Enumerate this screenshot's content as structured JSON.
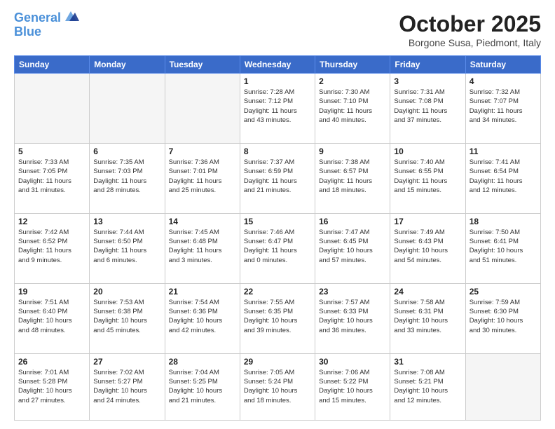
{
  "header": {
    "logo_line1": "General",
    "logo_line2": "Blue",
    "month_title": "October 2025",
    "location": "Borgone Susa, Piedmont, Italy"
  },
  "weekdays": [
    "Sunday",
    "Monday",
    "Tuesday",
    "Wednesday",
    "Thursday",
    "Friday",
    "Saturday"
  ],
  "weeks": [
    [
      {
        "day": "",
        "info": ""
      },
      {
        "day": "",
        "info": ""
      },
      {
        "day": "",
        "info": ""
      },
      {
        "day": "1",
        "info": "Sunrise: 7:28 AM\nSunset: 7:12 PM\nDaylight: 11 hours\nand 43 minutes."
      },
      {
        "day": "2",
        "info": "Sunrise: 7:30 AM\nSunset: 7:10 PM\nDaylight: 11 hours\nand 40 minutes."
      },
      {
        "day": "3",
        "info": "Sunrise: 7:31 AM\nSunset: 7:08 PM\nDaylight: 11 hours\nand 37 minutes."
      },
      {
        "day": "4",
        "info": "Sunrise: 7:32 AM\nSunset: 7:07 PM\nDaylight: 11 hours\nand 34 minutes."
      }
    ],
    [
      {
        "day": "5",
        "info": "Sunrise: 7:33 AM\nSunset: 7:05 PM\nDaylight: 11 hours\nand 31 minutes."
      },
      {
        "day": "6",
        "info": "Sunrise: 7:35 AM\nSunset: 7:03 PM\nDaylight: 11 hours\nand 28 minutes."
      },
      {
        "day": "7",
        "info": "Sunrise: 7:36 AM\nSunset: 7:01 PM\nDaylight: 11 hours\nand 25 minutes."
      },
      {
        "day": "8",
        "info": "Sunrise: 7:37 AM\nSunset: 6:59 PM\nDaylight: 11 hours\nand 21 minutes."
      },
      {
        "day": "9",
        "info": "Sunrise: 7:38 AM\nSunset: 6:57 PM\nDaylight: 11 hours\nand 18 minutes."
      },
      {
        "day": "10",
        "info": "Sunrise: 7:40 AM\nSunset: 6:55 PM\nDaylight: 11 hours\nand 15 minutes."
      },
      {
        "day": "11",
        "info": "Sunrise: 7:41 AM\nSunset: 6:54 PM\nDaylight: 11 hours\nand 12 minutes."
      }
    ],
    [
      {
        "day": "12",
        "info": "Sunrise: 7:42 AM\nSunset: 6:52 PM\nDaylight: 11 hours\nand 9 minutes."
      },
      {
        "day": "13",
        "info": "Sunrise: 7:44 AM\nSunset: 6:50 PM\nDaylight: 11 hours\nand 6 minutes."
      },
      {
        "day": "14",
        "info": "Sunrise: 7:45 AM\nSunset: 6:48 PM\nDaylight: 11 hours\nand 3 minutes."
      },
      {
        "day": "15",
        "info": "Sunrise: 7:46 AM\nSunset: 6:47 PM\nDaylight: 11 hours\nand 0 minutes."
      },
      {
        "day": "16",
        "info": "Sunrise: 7:47 AM\nSunset: 6:45 PM\nDaylight: 10 hours\nand 57 minutes."
      },
      {
        "day": "17",
        "info": "Sunrise: 7:49 AM\nSunset: 6:43 PM\nDaylight: 10 hours\nand 54 minutes."
      },
      {
        "day": "18",
        "info": "Sunrise: 7:50 AM\nSunset: 6:41 PM\nDaylight: 10 hours\nand 51 minutes."
      }
    ],
    [
      {
        "day": "19",
        "info": "Sunrise: 7:51 AM\nSunset: 6:40 PM\nDaylight: 10 hours\nand 48 minutes."
      },
      {
        "day": "20",
        "info": "Sunrise: 7:53 AM\nSunset: 6:38 PM\nDaylight: 10 hours\nand 45 minutes."
      },
      {
        "day": "21",
        "info": "Sunrise: 7:54 AM\nSunset: 6:36 PM\nDaylight: 10 hours\nand 42 minutes."
      },
      {
        "day": "22",
        "info": "Sunrise: 7:55 AM\nSunset: 6:35 PM\nDaylight: 10 hours\nand 39 minutes."
      },
      {
        "day": "23",
        "info": "Sunrise: 7:57 AM\nSunset: 6:33 PM\nDaylight: 10 hours\nand 36 minutes."
      },
      {
        "day": "24",
        "info": "Sunrise: 7:58 AM\nSunset: 6:31 PM\nDaylight: 10 hours\nand 33 minutes."
      },
      {
        "day": "25",
        "info": "Sunrise: 7:59 AM\nSunset: 6:30 PM\nDaylight: 10 hours\nand 30 minutes."
      }
    ],
    [
      {
        "day": "26",
        "info": "Sunrise: 7:01 AM\nSunset: 5:28 PM\nDaylight: 10 hours\nand 27 minutes."
      },
      {
        "day": "27",
        "info": "Sunrise: 7:02 AM\nSunset: 5:27 PM\nDaylight: 10 hours\nand 24 minutes."
      },
      {
        "day": "28",
        "info": "Sunrise: 7:04 AM\nSunset: 5:25 PM\nDaylight: 10 hours\nand 21 minutes."
      },
      {
        "day": "29",
        "info": "Sunrise: 7:05 AM\nSunset: 5:24 PM\nDaylight: 10 hours\nand 18 minutes."
      },
      {
        "day": "30",
        "info": "Sunrise: 7:06 AM\nSunset: 5:22 PM\nDaylight: 10 hours\nand 15 minutes."
      },
      {
        "day": "31",
        "info": "Sunrise: 7:08 AM\nSunset: 5:21 PM\nDaylight: 10 hours\nand 12 minutes."
      },
      {
        "day": "",
        "info": ""
      }
    ]
  ]
}
